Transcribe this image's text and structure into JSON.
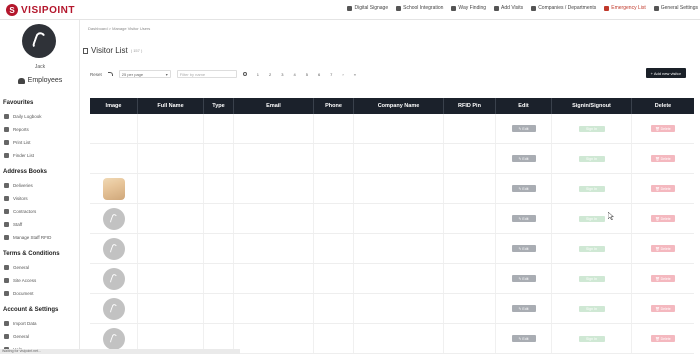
{
  "brand": {
    "name": "VISIPOINT",
    "mark": "S",
    "color": "#b4162c"
  },
  "topnav": [
    {
      "label": "Digital Signage",
      "icon": "signage-icon"
    },
    {
      "label": "School Integration",
      "icon": "school-icon"
    },
    {
      "label": "Way Finding",
      "icon": "map-icon"
    },
    {
      "label": "Add Visits",
      "icon": "plus-icon"
    },
    {
      "label": "Companies / Departments",
      "icon": "building-icon"
    },
    {
      "label": "Emergency List",
      "icon": "alert-icon"
    },
    {
      "label": "General Settings",
      "icon": "gear-icon"
    }
  ],
  "sidebar": {
    "username": "Jack",
    "employees_label": "Employees",
    "sections": [
      {
        "title": "Favourites",
        "items": [
          "Daily Logbook",
          "Reports",
          "Print List",
          "Finder List"
        ]
      },
      {
        "title": "Address Books",
        "items": [
          "Deliveries",
          "Visitors",
          "Contractors",
          "Staff",
          "Manage Staff RFID"
        ]
      },
      {
        "title": "Terms & Conditions",
        "items": [
          "General",
          "Site Access",
          "Document"
        ]
      },
      {
        "title": "Account & Settings",
        "items": [
          "Import Data",
          "General",
          "Help"
        ]
      }
    ]
  },
  "main": {
    "breadcrumb": "Dashboard > Manage Visitor Users",
    "title": "Visitor List",
    "title_count": "( 157 )",
    "reset_label": "Reset",
    "per_page": "25 per page",
    "filter_placeholder": "Filter by name",
    "pages": [
      "1",
      "2",
      "3",
      "4",
      "5",
      "6",
      "7",
      "›",
      "»"
    ],
    "add_button": "+ Add new visitor"
  },
  "table": {
    "headers": [
      "Image",
      "Full Name",
      "Type",
      "Email",
      "Phone",
      "Company Name",
      "RFID Pin",
      "Edit",
      "Signin/Signout",
      "Delete"
    ],
    "rows": [
      {
        "image": "blank",
        "edit": "✎ Edit",
        "sign": "Sign In",
        "delete": "🗑 Delete"
      },
      {
        "image": "blank",
        "edit": "✎ Edit",
        "sign": "Sign In",
        "delete": "🗑 Delete"
      },
      {
        "image": "photo",
        "edit": "✎ Edit",
        "sign": "Sign In",
        "delete": "🗑 Delete"
      },
      {
        "image": "avatar",
        "edit": "✎ Edit",
        "sign": "Sign In",
        "delete": "🗑 Delete"
      },
      {
        "image": "avatar",
        "edit": "✎ Edit",
        "sign": "Sign In",
        "delete": "🗑 Delete"
      },
      {
        "image": "avatar",
        "edit": "✎ Edit",
        "sign": "Sign In",
        "delete": "🗑 Delete"
      },
      {
        "image": "avatar",
        "edit": "✎ Edit",
        "sign": "Sign In",
        "delete": "🗑 Delete"
      },
      {
        "image": "avatar",
        "edit": "✎ Edit",
        "sign": "Sign In",
        "delete": "🗑 Delete"
      }
    ]
  },
  "statusbar": "Waiting for visipoint.net..."
}
